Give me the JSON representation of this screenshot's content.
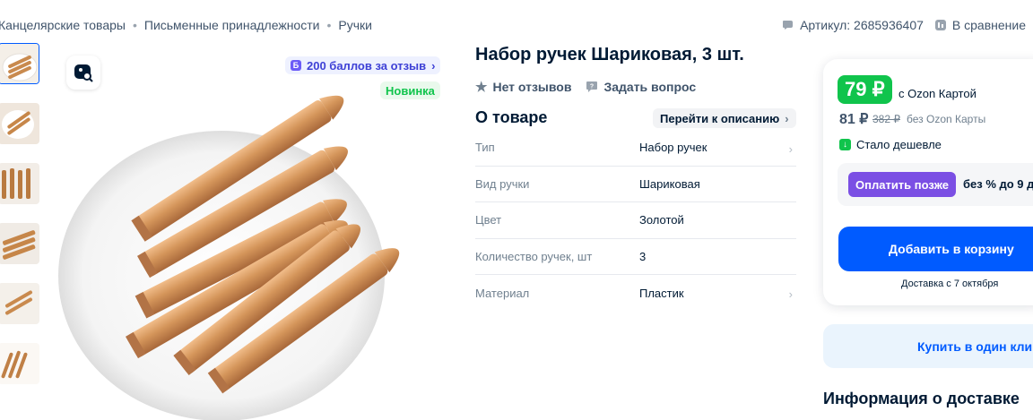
{
  "breadcrumbs": [
    "Канцелярские товары",
    "Письменные принадлежности",
    "Ручки"
  ],
  "header": {
    "article_label": "Артикул: 2685936407",
    "compare_label": "В сравнение"
  },
  "gallery": {
    "bonus_badge": "200 баллов за отзыв",
    "new_badge": "Новинка"
  },
  "product": {
    "title": "Набор ручек Шариковая, 3 шт.",
    "reviews_label": "Нет отзывов",
    "question_label": "Задать вопрос"
  },
  "about": {
    "heading": "О товаре",
    "goto_label": "Перейти к описанию",
    "specs": [
      {
        "key": "Тип",
        "value": "Набор ручек"
      },
      {
        "key": "Вид ручки",
        "value": "Шариковая"
      },
      {
        "key": "Цвет",
        "value": "Золотой"
      },
      {
        "key": "Количество ручек, шт",
        "value": "3"
      },
      {
        "key": "Материал",
        "value": "Пластик"
      }
    ]
  },
  "price": {
    "ozon_price": "79 ₽",
    "ozon_card_label": "с Ozon Картой",
    "regular_price": "81 ₽",
    "old_price": "382 ₽",
    "without_card_label": "без Ozon Карты",
    "cheaper_label": "Стало дешевле",
    "pay_later_button": "Оплатить позже",
    "pay_later_text": "без % до 9 д",
    "add_to_cart": "Добавить в корзину",
    "delivery_date": "Доставка с 7 октября"
  },
  "one_click": "Купить в один кли",
  "delivery_info_heading": "Информация о доставке",
  "colors": {
    "accent": "#005bff",
    "green": "#10c44c",
    "purple": "#7b4fe4"
  }
}
